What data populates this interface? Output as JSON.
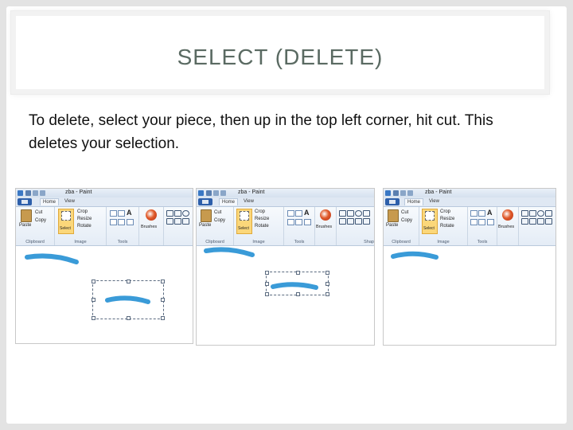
{
  "slide": {
    "title": "SELECT (DELETE)",
    "body": "To delete, select your piece, then up in the top left corner, hit cut. This deletes your selection."
  },
  "screenshots": [
    {
      "window_title": "zba - Paint",
      "tabs": [
        "Home",
        "View"
      ],
      "clipboard": {
        "paste": "Paste",
        "cut": "Cut",
        "copy": "Copy",
        "label": "Clipboard"
      },
      "image": {
        "select": "Select",
        "crop": "Crop",
        "resize": "Resize",
        "rotate": "Rotate",
        "label": "Image"
      },
      "tools_label": "Tools",
      "brushes": "Brushes",
      "state": "original"
    },
    {
      "window_title": "zba - Paint",
      "tabs": [
        "Home",
        "View"
      ],
      "clipboard": {
        "paste": "Paste",
        "cut": "Cut",
        "copy": "Copy",
        "label": "Clipboard"
      },
      "image": {
        "select": "Select",
        "crop": "Crop",
        "resize": "Resize",
        "rotate": "Rotate",
        "label": "Image"
      },
      "tools_label": "Tools",
      "brushes": "Brushes",
      "shapes_label": "Shap",
      "state": "selected"
    },
    {
      "window_title": "zba - Paint",
      "tabs": [
        "Home",
        "View"
      ],
      "clipboard": {
        "paste": "Paste",
        "cut": "Cut",
        "copy": "Copy",
        "label": "Clipboard"
      },
      "image": {
        "select": "Select",
        "crop": "Crop",
        "resize": "Resize",
        "rotate": "Rotate",
        "label": "Image"
      },
      "tools_label": "Tools",
      "brushes": "Brushes",
      "state": "deleted"
    }
  ],
  "colors": {
    "title_text": "#5a6a62",
    "stroke": "#3a9bd8",
    "ribbon_file": "#2d5faa",
    "select_highlight": "#fbd77a"
  }
}
